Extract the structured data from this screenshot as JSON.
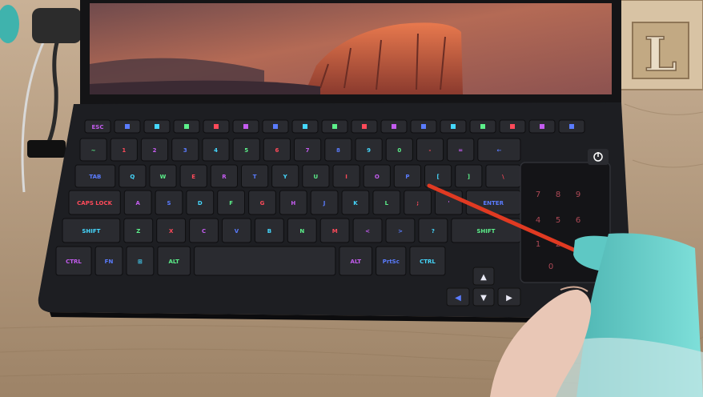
{
  "colors": {
    "table": "#b59c80",
    "table_dark": "#8a7560",
    "laptop_body": "#1d1e22",
    "key": "#2a2b30",
    "backlight_purple": "#c45cf0",
    "backlight_blue": "#5a7cff",
    "backlight_cyan": "#45d8ff",
    "backlight_green": "#5cf08a",
    "backlight_red": "#ff4a5a",
    "nozzle": "#e03a22",
    "bottle_teal": "#5ec8c4"
  },
  "keyboard": {
    "rows": [
      [
        "ESC",
        "",
        "",
        "",
        "",
        "",
        "",
        "",
        "",
        "",
        "",
        "",
        "",
        "",
        "",
        "",
        ""
      ],
      [
        "~",
        "1",
        "2",
        "3",
        "4",
        "5",
        "6",
        "7",
        "8",
        "9",
        "0",
        "-",
        "=",
        "←"
      ],
      [
        "TAB",
        "Q",
        "W",
        "E",
        "R",
        "T",
        "Y",
        "U",
        "I",
        "O",
        "P",
        "[",
        "]",
        "\\"
      ],
      [
        "CAPS LOCK",
        "A",
        "S",
        "D",
        "F",
        "G",
        "H",
        "J",
        "K",
        "L",
        ";",
        "'",
        "ENTER"
      ],
      [
        "SHIFT",
        "Z",
        "X",
        "C",
        "V",
        "B",
        "N",
        "M",
        "<",
        ">",
        "?",
        "SHIFT"
      ],
      [
        "CTRL",
        "FN",
        "⊞",
        "ALT",
        "",
        "ALT",
        "PrtSc",
        "CTRL"
      ]
    ],
    "numpad": [
      "7",
      "8",
      "9",
      "4",
      "5",
      "6",
      "1",
      "2",
      "3",
      "0"
    ]
  },
  "decor_letter": "L"
}
